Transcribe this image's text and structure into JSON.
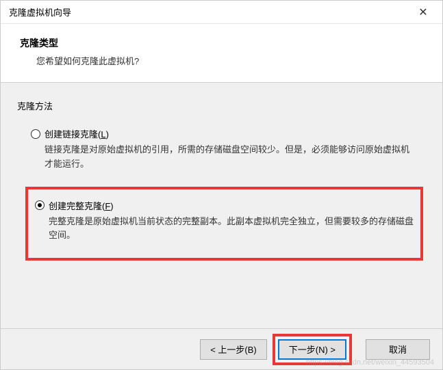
{
  "titlebar": {
    "title": "克隆虚拟机向导",
    "close_icon": "✕"
  },
  "header": {
    "title": "克隆类型",
    "subtitle": "您希望如何克隆此虚拟机?"
  },
  "content": {
    "section_label": "克隆方法",
    "options": [
      {
        "label_prefix": "创建链接克隆(",
        "label_key": "L",
        "label_suffix": ")",
        "desc": "链接克隆是对原始虚拟机的引用，所需的存储磁盘空间较少。但是，必须能够访问原始虚拟机才能运行。",
        "selected": false
      },
      {
        "label_prefix": "创建完整克隆(",
        "label_key": "F",
        "label_suffix": ")",
        "desc": "完整克隆是原始虚拟机当前状态的完整副本。此副本虚拟机完全独立，但需要较多的存储磁盘空间。",
        "selected": true
      }
    ]
  },
  "buttons": {
    "back": "< 上一步(B)",
    "next": "下一步(N) >",
    "cancel": "取消"
  },
  "watermark": "https://blog.csdn.net/weixin_44593504"
}
